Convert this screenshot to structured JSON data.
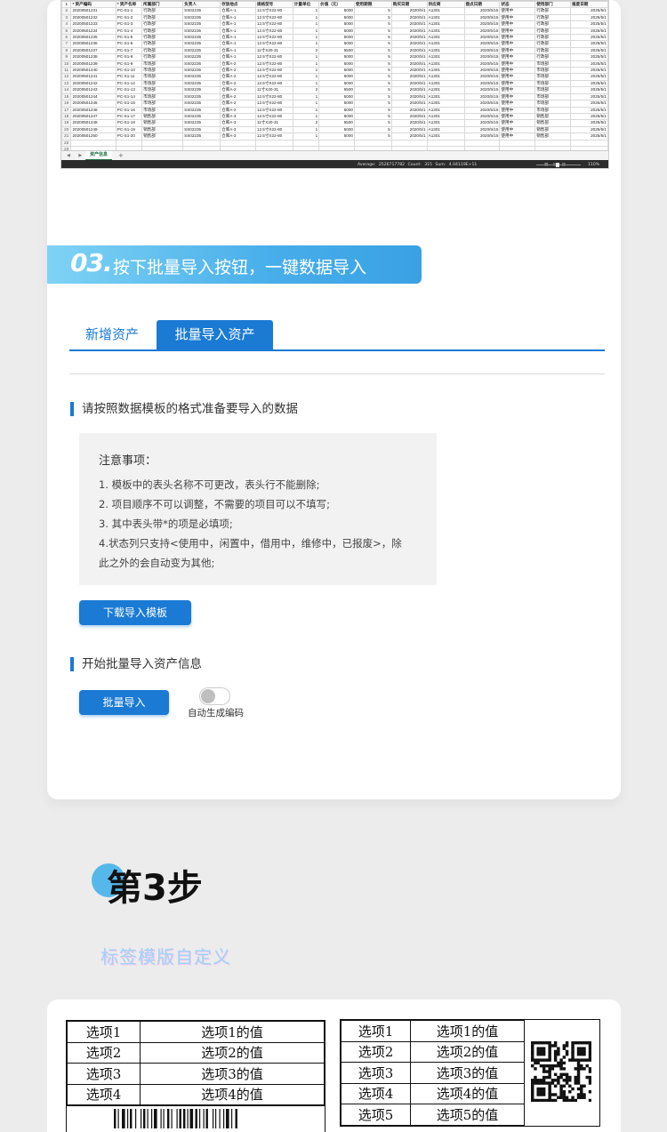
{
  "spreadsheet": {
    "headers": [
      "",
      "* 资产编码",
      "* 资产名称",
      "所属部门",
      "负责人",
      "存放地点",
      "规格型号",
      "计量单位",
      "价值（元）",
      "使用期限",
      "购买日期",
      "供应商",
      "盘点日期",
      "状态",
      "使用部门",
      "报废日期"
    ],
    "rows": [
      [
        "2",
        "20200501231",
        "PC-S1-1",
        "行政部",
        "SS02235",
        "仓库A-1",
        "12.5寸X22-80",
        "1",
        "5000",
        "5",
        "2020/5/1",
        "A1301",
        "2020/5/15",
        "使用中",
        "行政部",
        "2025/5/1"
      ],
      [
        "3",
        "20200501232",
        "PC-S1-2",
        "行政部",
        "SS02235",
        "仓库A-1",
        "12.5寸X22-80",
        "1",
        "5000",
        "5",
        "2020/5/1",
        "A1301",
        "2020/5/15",
        "使用中",
        "行政部",
        "2025/5/1"
      ],
      [
        "4",
        "20200501233",
        "PC-S1-3",
        "行政部",
        "SS02235",
        "仓库A-1",
        "12.5寸X22-80",
        "1",
        "5000",
        "5",
        "2020/5/1",
        "A1301",
        "2020/5/15",
        "使用中",
        "行政部",
        "2025/5/1"
      ],
      [
        "5",
        "20200501234",
        "PC-S1-4",
        "行政部",
        "SS02235",
        "仓库A-1",
        "12.5寸X22-80",
        "1",
        "5000",
        "5",
        "2020/5/1",
        "A1301",
        "2020/5/15",
        "使用中",
        "行政部",
        "2025/5/1"
      ],
      [
        "6",
        "20200501235",
        "PC-S1-5",
        "行政部",
        "SS02235",
        "仓库A-1",
        "12.5寸X22-80",
        "1",
        "5000",
        "5",
        "2020/5/1",
        "A1301",
        "2020/5/15",
        "使用中",
        "行政部",
        "2025/5/1"
      ],
      [
        "7",
        "20200501236",
        "PC-S1-6",
        "行政部",
        "SS02235",
        "仓库A-1",
        "12.5寸X22-80",
        "1",
        "5000",
        "5",
        "2020/5/1",
        "A1301",
        "2020/5/15",
        "使用中",
        "行政部",
        "2025/5/1"
      ],
      [
        "8",
        "20200501237",
        "PC-S1-7",
        "行政部",
        "SS02235",
        "仓库A-1",
        "11寸X20-31",
        "2",
        "5500",
        "5",
        "2020/5/1",
        "A1301",
        "2020/5/15",
        "使用中",
        "行政部",
        "2025/5/1"
      ],
      [
        "9",
        "20200501238",
        "PC-S1-8",
        "行政部",
        "SS02235",
        "仓库A-1",
        "12.5寸X22-80",
        "1",
        "5000",
        "5",
        "2020/5/1",
        "A1301",
        "2020/5/15",
        "使用中",
        "行政部",
        "2025/5/1"
      ],
      [
        "10",
        "20200501239",
        "PC-S1-9",
        "市场部",
        "SS02235",
        "仓库A-2",
        "12.5寸X22-80",
        "1",
        "5000",
        "5",
        "2020/5/1",
        "A1301",
        "2020/5/15",
        "使用中",
        "市场部",
        "2025/5/1"
      ],
      [
        "11",
        "20200501240",
        "PC-S1-10",
        "市场部",
        "SS02235",
        "仓库A-2",
        "12.5寸X22-80",
        "1",
        "5000",
        "5",
        "2020/5/1",
        "A1301",
        "2020/5/15",
        "使用中",
        "市场部",
        "2025/5/1"
      ],
      [
        "12",
        "20200501241",
        "PC-S1-11",
        "市场部",
        "SS02235",
        "仓库A-2",
        "12.5寸X22-80",
        "1",
        "5000",
        "5",
        "2020/5/1",
        "A1301",
        "2020/5/15",
        "使用中",
        "市场部",
        "2025/5/1"
      ],
      [
        "13",
        "20200501242",
        "PC-S1-12",
        "市场部",
        "SS02235",
        "仓库A-2",
        "12.5寸X22-80",
        "1",
        "5000",
        "5",
        "2020/5/1",
        "A1301",
        "2020/5/15",
        "使用中",
        "市场部",
        "2025/5/1"
      ],
      [
        "14",
        "20200501243",
        "PC-S1-13",
        "市场部",
        "SS02235",
        "仓库A-2",
        "11寸X20-31",
        "2",
        "5500",
        "5",
        "2020/5/1",
        "A1301",
        "2020/5/15",
        "使用中",
        "市场部",
        "2025/5/1"
      ],
      [
        "15",
        "20200501244",
        "PC-S1-14",
        "市场部",
        "SS02235",
        "仓库A-2",
        "12.5寸X22-80",
        "1",
        "5000",
        "5",
        "2020/5/1",
        "A1301",
        "2020/5/15",
        "使用中",
        "市场部",
        "2025/5/1"
      ],
      [
        "16",
        "20200501245",
        "PC-S1-15",
        "市场部",
        "SS02235",
        "仓库A-2",
        "12.5寸X22-80",
        "1",
        "5000",
        "5",
        "2020/5/1",
        "A1301",
        "2020/5/15",
        "使用中",
        "市场部",
        "2025/5/1"
      ],
      [
        "17",
        "20200501246",
        "PC-S1-16",
        "市场部",
        "SS02235",
        "仓库A-2",
        "12.5寸X22-80",
        "1",
        "5000",
        "5",
        "2020/5/1",
        "A1301",
        "2020/5/15",
        "使用中",
        "市场部",
        "2025/5/1"
      ],
      [
        "18",
        "20200501247",
        "PC-S1-17",
        "销售部",
        "SS02235",
        "仓库A-3",
        "12.5寸X22-80",
        "1",
        "5000",
        "5",
        "2020/5/1",
        "A1301",
        "2020/5/15",
        "使用中",
        "销售部",
        "2025/5/1"
      ],
      [
        "19",
        "20200501248",
        "PC-S1-18",
        "销售部",
        "SS02235",
        "仓库A-3",
        "11寸X20-31",
        "2",
        "5500",
        "5",
        "2020/5/1",
        "A1301",
        "2020/5/15",
        "使用中",
        "销售部",
        "2025/5/1"
      ],
      [
        "20",
        "20200501249",
        "PC-S1-19",
        "销售部",
        "SS02235",
        "仓库A-3",
        "12.5寸X22-80",
        "1",
        "5000",
        "5",
        "2020/5/1",
        "A1301",
        "2020/5/15",
        "使用中",
        "销售部",
        "2025/5/1"
      ],
      [
        "21",
        "20200501250",
        "PC-S1-20",
        "销售部",
        "SS02235",
        "仓库A-3",
        "12.5寸X22-80",
        "1",
        "5000",
        "5",
        "2020/5/1",
        "A1301",
        "2020/5/15",
        "使用中",
        "销售部",
        "2025/5/1"
      ],
      [
        "22",
        "",
        "",
        "",
        "",
        "",
        "",
        "",
        "",
        "",
        "",
        "",
        "",
        "",
        "",
        ""
      ],
      [
        "23",
        "",
        "",
        "",
        "",
        "",
        "",
        "",
        "",
        "",
        "",
        "",
        "",
        "",
        "",
        ""
      ]
    ],
    "sheet_tab": "资产信息",
    "add_sheet": "+",
    "tab_arrows": "◀ ▶",
    "status_stats": "Average: 2526717782    Count: 315    Sum: 4.04119E+11",
    "view_icons": "▦ ▤ ▥",
    "zoom": "110%"
  },
  "step03": {
    "number": "03.",
    "text": "按下批量导入按钮，一键数据导入"
  },
  "tabs": {
    "new_asset": "新增资产",
    "batch_import": "批量导入资产"
  },
  "section1_title": "请按照数据模板的格式准备要导入的数据",
  "notes": {
    "title": "注意事项：",
    "items": [
      "1. 模板中的表头名称不可更改，表头行不能删除;",
      "2. 项目顺序不可以调整，不需要的项目可以不填写;",
      "3. 其中表头带*的项是必填项;",
      "4.状态列只支持<使用中，闲置中，借用中，维修中，已报废>，除",
      "此之外的会自动变为其他;"
    ]
  },
  "download_button": "下载导入模板",
  "section2_title": "开始批量导入资产信息",
  "import_button": "批量导入",
  "auto_code_label": "自动生成编码",
  "auto_code_enabled": false,
  "step3": {
    "title": "第3步",
    "subtitle": "标签模版自定义"
  },
  "label_template_1": {
    "rows": [
      {
        "key": "选项1",
        "value": "选项1的值"
      },
      {
        "key": "选项2",
        "value": "选项2的值"
      },
      {
        "key": "选项3",
        "value": "选项3的值"
      },
      {
        "key": "选项4",
        "value": "选项4的值"
      }
    ]
  },
  "label_template_2": {
    "rows": [
      {
        "key": "选项1",
        "value": "选项1的值"
      },
      {
        "key": "选项2",
        "value": "选项2的值"
      },
      {
        "key": "选项3",
        "value": "选项3的值"
      },
      {
        "key": "选项4",
        "value": "选项4的值"
      },
      {
        "key": "选项5",
        "value": "选项5的值"
      }
    ]
  },
  "colors": {
    "accent": "#1a7ad4",
    "banner_light": "#7fd3f5",
    "banner_dark": "#3aa1e4",
    "excel_green": "#217346"
  }
}
